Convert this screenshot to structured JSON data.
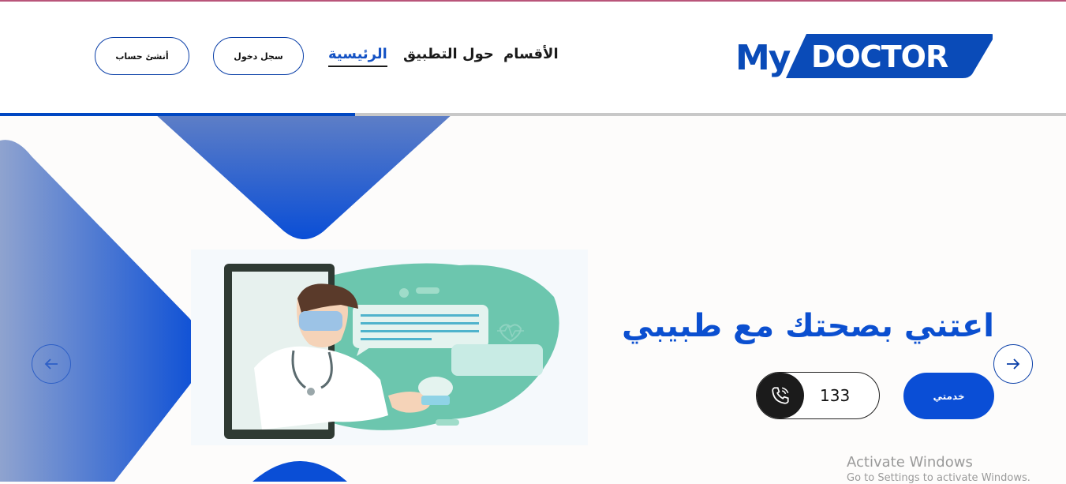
{
  "brand": {
    "logo_my": "My",
    "logo_doctor": "DOCTOR",
    "primary_color": "#0a4bb8",
    "accent_color": "#0a4ed6"
  },
  "nav": {
    "home": "الرئيسية",
    "about": "حول التطبيق",
    "sections": "الأقسام"
  },
  "auth": {
    "login": "سجل دخول",
    "signup": "أنشئ حساب"
  },
  "hero": {
    "title": "اعتني بصحتك مع طبيبي",
    "primary_button": "خدمتي",
    "hotline": "133",
    "illustration_bubble_icon": "heartbeat-icon"
  },
  "carousel": {
    "prev_icon": "arrow-left-icon",
    "next_icon": "arrow-right-icon"
  },
  "os_watermark": {
    "line1": "Activate Windows",
    "line2": "Go to Settings to activate Windows."
  }
}
